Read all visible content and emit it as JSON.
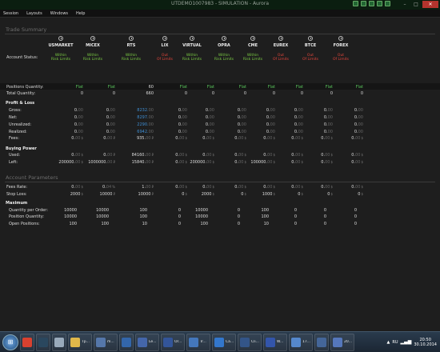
{
  "window": {
    "title": "UTDEMO1007983 - SIMULATION - Aurora"
  },
  "menu": [
    "Session",
    "Layouts",
    "Windows",
    "Help"
  ],
  "trade_summary": {
    "heading": "Trade Summary",
    "account_status_label": "Account Status:",
    "markets": [
      {
        "name": "USMARKET",
        "status1": "Within",
        "status2": "Risk Limits",
        "status_color": "#7ac943"
      },
      {
        "name": "MICEX",
        "status1": "Within",
        "status2": "Risk Limits",
        "status_color": "#7ac943"
      },
      {
        "name": "RTS",
        "status1": "Within",
        "status2": "Risk Limits",
        "status_color": "#7ac943"
      },
      {
        "name": "LIX",
        "status1": "Out",
        "status2": "Of Limits",
        "status_color": "#e0443a"
      },
      {
        "name": "VIRTUAL",
        "status1": "Within",
        "status2": "Risk Limits",
        "status_color": "#7ac943"
      },
      {
        "name": "OPRA",
        "status1": "Within",
        "status2": "Risk Limits",
        "status_color": "#7ac943"
      },
      {
        "name": "CME",
        "status1": "Within",
        "status2": "Risk Limits",
        "status_color": "#7ac943"
      },
      {
        "name": "EUREX",
        "status1": "Out",
        "status2": "Of Limits",
        "status_color": "#e0443a"
      },
      {
        "name": "BTCE",
        "status1": "Out",
        "status2": "Of Limits",
        "status_color": "#e0443a"
      },
      {
        "name": "FOREX",
        "status1": "Out",
        "status2": "Of Limits",
        "status_color": "#e0443a"
      }
    ],
    "positions_quantity_label": "Positions Quantity:",
    "positions_quantity": [
      "Flat",
      "Flat",
      "60",
      "Flat",
      "Flat",
      "Flat",
      "Flat",
      "Flat",
      "Flat",
      "Flat"
    ],
    "total_quantity_label": "Total Quantity:",
    "total_quantity": [
      "0",
      "0",
      "660",
      "0",
      "0",
      "0",
      "0",
      "0",
      "0",
      "0"
    ]
  },
  "profit_loss": {
    "heading": "Profit & Loss",
    "rows": [
      {
        "label": "Gross:",
        "values": [
          [
            "0.",
            "00"
          ],
          [
            "0.",
            "00"
          ],
          [
            "8232.",
            "00"
          ],
          [
            "0.",
            "00"
          ],
          [
            "0.",
            "00"
          ],
          [
            "0.",
            "00"
          ],
          [
            "0.",
            "00"
          ],
          [
            "0.",
            "00"
          ],
          [
            "0.",
            "00"
          ],
          [
            "0.",
            "00"
          ]
        ],
        "highlight": 2
      },
      {
        "label": "Net:",
        "values": [
          [
            "0.",
            "00"
          ],
          [
            "0.",
            "00"
          ],
          [
            "8297.",
            "00"
          ],
          [
            "0.",
            "00"
          ],
          [
            "0.",
            "00"
          ],
          [
            "0.",
            "00"
          ],
          [
            "0.",
            "00"
          ],
          [
            "0.",
            "00"
          ],
          [
            "0.",
            "00"
          ],
          [
            "0.",
            "00"
          ]
        ],
        "highlight": 2
      },
      {
        "label": "Unrealized:",
        "values": [
          [
            "0.",
            "00"
          ],
          [
            "0.",
            "00"
          ],
          [
            "2290.",
            "00"
          ],
          [
            "0.",
            "00"
          ],
          [
            "0.",
            "00"
          ],
          [
            "0.",
            "00"
          ],
          [
            "0.",
            "00"
          ],
          [
            "0.",
            "00"
          ],
          [
            "0.",
            "00"
          ],
          [
            "0.",
            "00"
          ]
        ],
        "highlight": 2
      },
      {
        "label": "Realized:",
        "values": [
          [
            "0.",
            "00"
          ],
          [
            "0.",
            "00"
          ],
          [
            "6942.",
            "00"
          ],
          [
            "0.",
            "00"
          ],
          [
            "0.",
            "00"
          ],
          [
            "0.",
            "00"
          ],
          [
            "0.",
            "00"
          ],
          [
            "0.",
            "00"
          ],
          [
            "0.",
            "00"
          ],
          [
            "0.",
            "00"
          ]
        ],
        "highlight": 2
      },
      {
        "label": "Fees:",
        "values": [
          [
            "0.",
            "00"
          ],
          [
            "0.",
            "00"
          ],
          [
            "935.",
            "00"
          ],
          [
            "0.",
            "00"
          ],
          [
            "0.",
            "00"
          ],
          [
            "0.",
            "00"
          ],
          [
            "0.",
            "00"
          ],
          [
            "0.",
            "00"
          ],
          [
            "0.",
            "00"
          ],
          [
            "0.",
            "00"
          ]
        ],
        "highlight": -1
      },
      {
        "label": "Used:",
        "values": [
          [
            "0.",
            "00"
          ],
          [
            "0.",
            "00"
          ],
          [
            "84160.",
            "00"
          ],
          [
            "0.",
            "00"
          ],
          [
            "0.",
            "00"
          ],
          [
            "0.",
            "00"
          ],
          [
            "0.",
            "00"
          ],
          [
            "0.",
            "00"
          ],
          [
            "0.",
            "00"
          ],
          [
            "0.",
            "00"
          ]
        ],
        "highlight": -1
      },
      {
        "label": "Left:",
        "values": [
          [
            "200000.",
            "00"
          ],
          [
            "1000000.",
            "00"
          ],
          [
            "15840.",
            "00"
          ],
          [
            "0.",
            "00"
          ],
          [
            "200000.",
            "00"
          ],
          [
            "0.",
            "00"
          ],
          [
            "100000.",
            "00"
          ],
          [
            "0.",
            "00"
          ],
          [
            "0.",
            "00"
          ],
          [
            "0.",
            "00"
          ]
        ],
        "highlight": -1
      }
    ],
    "currency": [
      "$",
      "₽",
      "₽",
      "$",
      "$",
      "$",
      "$",
      "$",
      "$",
      "$"
    ]
  },
  "buying_power": {
    "heading": "Buying Power"
  },
  "account_parameters": {
    "heading": "Account Parameters",
    "fees_rate_label": "Fees Rate:",
    "fees_rate": [
      [
        "0.",
        "00",
        "$"
      ],
      [
        "0.",
        "04",
        "%"
      ],
      [
        "1.",
        "00",
        "₽"
      ],
      [
        "0.",
        "00",
        "$"
      ],
      [
        "0.",
        "00",
        "$"
      ],
      [
        "0.",
        "00",
        "$"
      ],
      [
        "0.",
        "00",
        "$"
      ],
      [
        "0.",
        "00",
        "$"
      ],
      [
        "0.",
        "00",
        "$"
      ],
      [
        "0.",
        "00",
        "$"
      ]
    ],
    "stop_loss_label": "Stop Loss:",
    "stop_loss": [
      [
        "2000",
        "$"
      ],
      [
        "10000",
        "₽"
      ],
      [
        "10000",
        "₽"
      ],
      [
        "0",
        "$"
      ],
      [
        "2000",
        "$"
      ],
      [
        "0",
        "$"
      ],
      [
        "1000",
        "$"
      ],
      [
        "0",
        "$"
      ],
      [
        "0",
        "$"
      ],
      [
        "0",
        "$"
      ]
    ]
  },
  "maximum": {
    "heading": "Maximum",
    "rows": [
      {
        "label": "Quantity per Order:",
        "values": [
          "10000",
          "10000",
          "100",
          "0",
          "10000",
          "0",
          "100",
          "0",
          "0",
          "0"
        ]
      },
      {
        "label": "Position Quantity:",
        "values": [
          "10000",
          "10000",
          "100",
          "0",
          "10000",
          "0",
          "100",
          "0",
          "0",
          "0"
        ]
      },
      {
        "label": "Open Positions:",
        "values": [
          "100",
          "100",
          "10",
          "0",
          "100",
          "0",
          "10",
          "0",
          "0",
          "0"
        ]
      }
    ]
  },
  "taskbar": {
    "items": [
      {
        "icon": "chrome-icon",
        "color": "#d9412f",
        "label": ""
      },
      {
        "icon": "steam-icon",
        "color": "#2a475e",
        "label": ""
      },
      {
        "icon": "clock-app-icon",
        "color": "#9ab",
        "label": ""
      },
      {
        "icon": "folder-icon",
        "color": "#e0b84a",
        "label": "Тр..."
      },
      {
        "icon": "app-icon",
        "color": "#5577aa",
        "label": "m..."
      },
      {
        "icon": "app-icon",
        "color": "#3366aa",
        "label": ""
      },
      {
        "icon": "app-icon",
        "color": "#4466aa",
        "label": "Le..."
      },
      {
        "icon": "app-icon",
        "color": "#335599",
        "label": "Or..."
      },
      {
        "icon": "app-icon",
        "color": "#4477bb",
        "label": "Tr..."
      },
      {
        "icon": "app-icon",
        "color": "#3377cc",
        "label": "Ca..."
      },
      {
        "icon": "app-icon",
        "color": "#335588",
        "label": "Cli..."
      },
      {
        "icon": "app-icon",
        "color": "#3355aa",
        "label": "W..."
      },
      {
        "icon": "app-icon",
        "color": "#5588cc",
        "label": "17..."
      },
      {
        "icon": "app-icon",
        "color": "#446699",
        "label": ""
      },
      {
        "icon": "app-icon",
        "color": "#5577bb",
        "label": "20..."
      }
    ],
    "lang": "RU",
    "time": "20:50",
    "date": "30.10.2014"
  }
}
